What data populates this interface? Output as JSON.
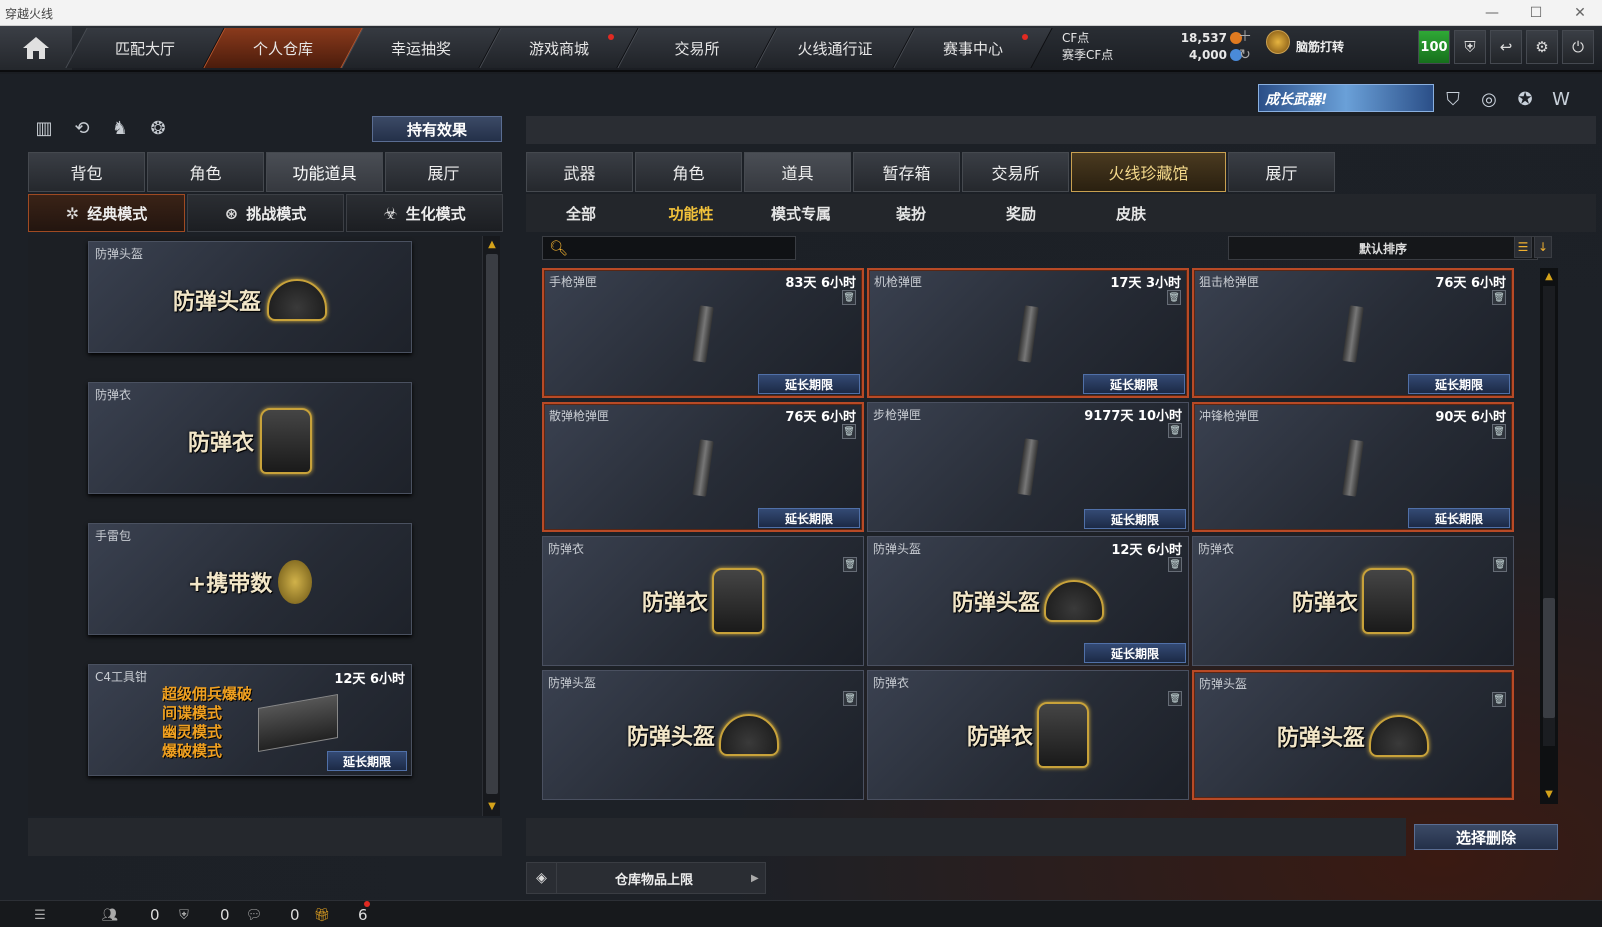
{
  "window": {
    "title": "穿越火线"
  },
  "nav": {
    "tabs": [
      {
        "label": "匹配大厅",
        "active": false,
        "dot": false
      },
      {
        "label": "个人仓库",
        "active": true,
        "dot": false
      },
      {
        "label": "幸运抽奖",
        "active": false,
        "dot": false
      },
      {
        "label": "游戏商城",
        "active": false,
        "dot": true
      },
      {
        "label": "交易所",
        "active": false,
        "dot": false
      },
      {
        "label": "火线通行证",
        "active": false,
        "dot": false
      },
      {
        "label": "赛事中心",
        "active": false,
        "dot": true
      }
    ]
  },
  "currency": {
    "cf_label": "CF点",
    "cf_value": "18,537",
    "season_label": "赛季CF点",
    "season_value": "4,000"
  },
  "user": {
    "name": "脑筋打转",
    "level": "100"
  },
  "promo": {
    "text": "成长武器!"
  },
  "left": {
    "effect_button": "持有效果",
    "tabs": [
      "背包",
      "角色",
      "功能道具",
      "展厅"
    ],
    "active_tab": 2,
    "modes": [
      "经典模式",
      "挑战模式",
      "生化模式"
    ],
    "items": [
      {
        "name": "防弹头盔",
        "art_text": "防弹头盔",
        "time": "",
        "extend": ""
      },
      {
        "name": "防弹衣",
        "art_text": "防弹衣",
        "time": "",
        "extend": ""
      },
      {
        "name": "手雷包",
        "art_text": "+携带数",
        "time": "",
        "extend": ""
      },
      {
        "name": "C4工具钳",
        "art_lines": [
          "超级佣兵爆破",
          "间谍模式",
          "幽灵模式",
          "爆破模式"
        ],
        "time": "12天 6小时",
        "extend": "延长期限"
      }
    ]
  },
  "right": {
    "tabs": [
      "武器",
      "角色",
      "道具",
      "暂存箱",
      "交易所",
      "火线珍藏馆",
      "展厅"
    ],
    "active_tab": 2,
    "subtabs": [
      "全部",
      "功能性",
      "模式专属",
      "装扮",
      "奖励",
      "皮肤"
    ],
    "active_subtab": 1,
    "search_placeholder": "",
    "sort_label": "默认排序",
    "items": [
      {
        "name": "手枪弹匣",
        "time": "83天 6小时",
        "extend": "延长期限",
        "art": "ammo",
        "art_text": ""
      },
      {
        "name": "机枪弹匣",
        "time": "17天 3小时",
        "extend": "延长期限",
        "art": "ammo",
        "art_text": ""
      },
      {
        "name": "狙击枪弹匣",
        "time": "76天 6小时",
        "extend": "延长期限",
        "art": "ammo",
        "art_text": ""
      },
      {
        "name": "散弹枪弹匣",
        "time": "76天 6小时",
        "extend": "延长期限",
        "art": "ammo",
        "art_text": ""
      },
      {
        "name": "步枪弹匣",
        "time": "9177天 10小时",
        "extend": "延长期限",
        "art": "ammo",
        "art_text": ""
      },
      {
        "name": "冲锋枪弹匣",
        "time": "90天 6小时",
        "extend": "延长期限",
        "art": "ammo",
        "art_text": ""
      },
      {
        "name": "防弹衣",
        "time": "",
        "extend": "",
        "art": "vest",
        "art_text": "防弹衣"
      },
      {
        "name": "防弹头盔",
        "time": "12天 6小时",
        "extend": "延长期限",
        "art": "helmet",
        "art_text": "防弹头盔"
      },
      {
        "name": "防弹衣",
        "time": "",
        "extend": "",
        "art": "vest",
        "art_text": "防弹衣"
      },
      {
        "name": "防弹头盔",
        "time": "",
        "extend": "",
        "art": "helmet",
        "art_text": "防弹头盔"
      },
      {
        "name": "防弹衣",
        "time": "",
        "extend": "",
        "art": "vest",
        "art_text": "防弹衣"
      },
      {
        "name": "防弹头盔",
        "time": "",
        "extend": "",
        "art": "helmet",
        "art_text": "防弹头盔"
      }
    ],
    "delete_button": "选择删除",
    "storage_limit": "仓库物品上限"
  },
  "status": {
    "counts": [
      "0",
      "0",
      "0",
      "6"
    ]
  }
}
